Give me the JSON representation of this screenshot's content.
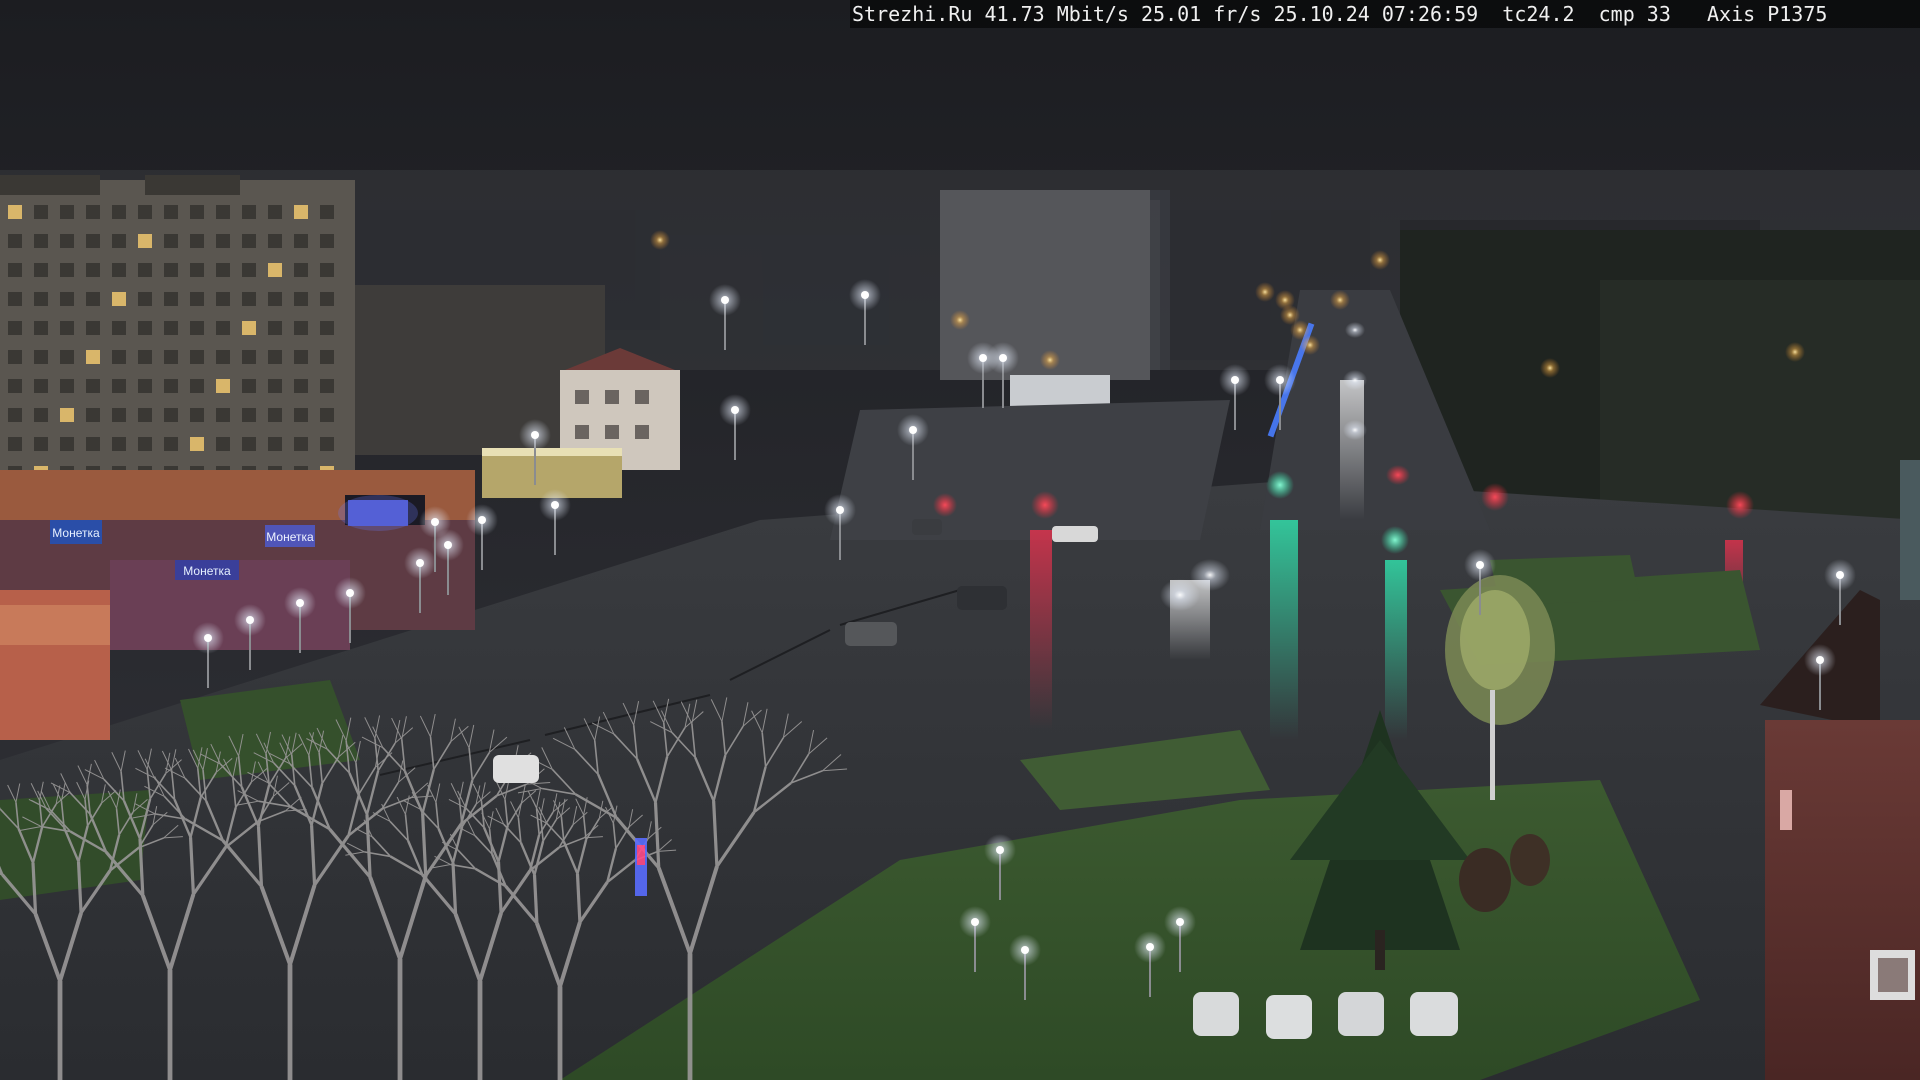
{
  "overlay": {
    "site": "Strezhi.Ru",
    "bitrate": "41.73 Mbit/s",
    "framerate": "25.01 fr/s",
    "datetime": "25.10.24 07:26:59",
    "tc": "tc24.2",
    "cmp": "cmp 33",
    "camera": "Axis P1375"
  },
  "scene": {
    "store_signs": [
      "Монетка",
      "Монетка",
      "Монетка"
    ]
  }
}
